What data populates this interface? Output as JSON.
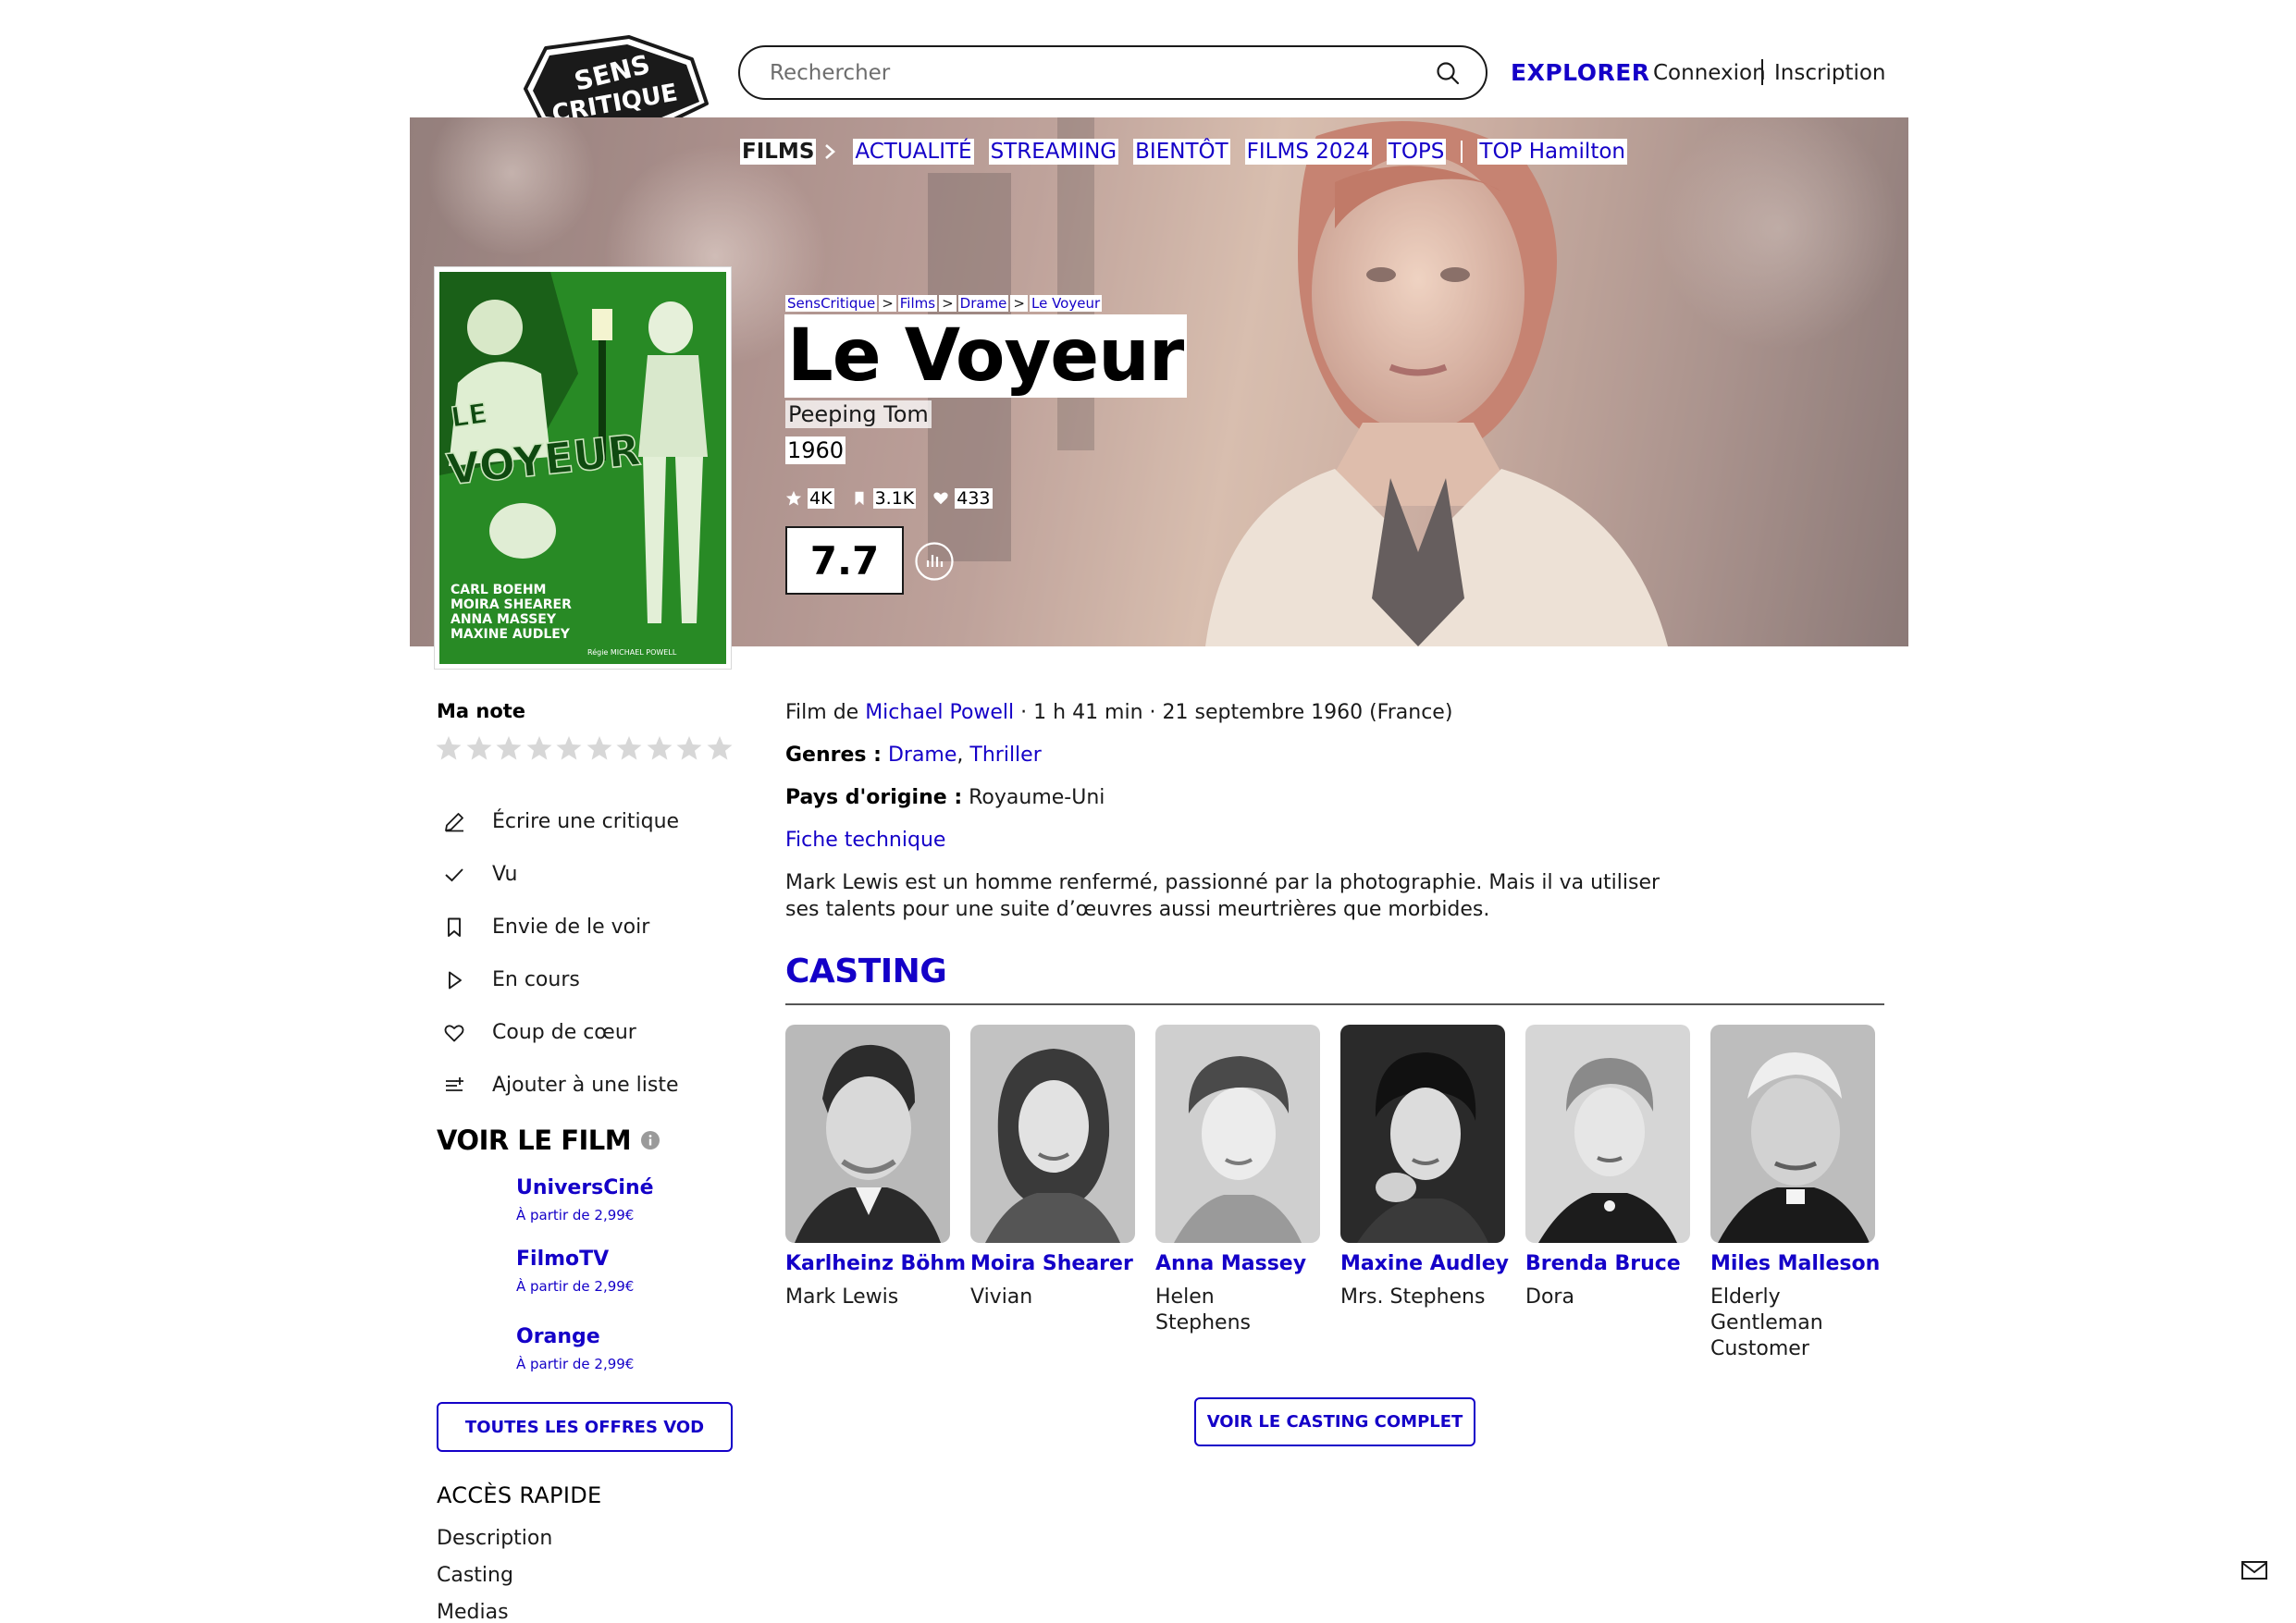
{
  "header": {
    "logo_line1": "SENS",
    "logo_line2": "CRITIQUE",
    "search_placeholder": "Rechercher",
    "explorer": "EXPLORER",
    "login": "Connexion",
    "signup": "Inscription"
  },
  "nav": {
    "items": [
      "FILMS",
      "ACTUALITÉ",
      "STREAMING",
      "BIENTÔT",
      "FILMS 2024",
      "TOPS",
      "TOP Hamilton"
    ]
  },
  "breadcrumb": [
    "SensCritique",
    "Films",
    "Drame",
    "Le Voyeur"
  ],
  "breadcrumb_sep": ">",
  "film": {
    "title": "Le Voyeur",
    "original_title": "Peeping Tom",
    "year": "1960",
    "stats": {
      "ratings": "4K",
      "wishlist": "3.1K",
      "favorites": "433"
    },
    "rating": "7.7",
    "poster": {
      "title_word1": "LE",
      "title_word2": "VOYEUR",
      "cast_lines": [
        "CARL BOEHM",
        "MOIRA SHEARER",
        "ANNA MASSEY",
        "MAXINE AUDLEY"
      ],
      "director_credit": "Régie MICHAEL POWELL"
    },
    "credits_prefix": "Film de",
    "director": "Michael Powell",
    "credits_suffix": "· 1 h 41 min · 21 septembre 1960 (France)",
    "genres_label": "Genres :",
    "genres": [
      "Drame",
      "Thriller"
    ],
    "genre_sep": ",",
    "country_label": "Pays d'origine :",
    "country": "Royaume-Uni",
    "tech_sheet": "Fiche technique",
    "synopsis": "Mark Lewis est un homme renfermé, passionné par la photographie. Mais il va utiliser ses talents pour une suite d’œuvres aussi meurtrières que morbides."
  },
  "sidebar": {
    "my_rating": "Ma note",
    "stars_count": 10,
    "actions": [
      {
        "icon": "pencil-icon",
        "label": "Écrire une critique"
      },
      {
        "icon": "check-icon",
        "label": "Vu"
      },
      {
        "icon": "bookmark-icon",
        "label": "Envie de le voir"
      },
      {
        "icon": "play-icon",
        "label": "En cours"
      },
      {
        "icon": "heart-icon",
        "label": "Coup de cœur"
      },
      {
        "icon": "list-add-icon",
        "label": "Ajouter à une liste"
      }
    ],
    "watch_title": "VOIR LE FILM",
    "vod": [
      {
        "name": "UniversCiné",
        "price": "À partir de 2,99€"
      },
      {
        "name": "FilmoTV",
        "price": "À partir de 2,99€"
      },
      {
        "name": "Orange",
        "price": "À partir de 2,99€"
      }
    ],
    "vod_all": "TOUTES LES OFFRES VOD",
    "quick_title": "ACCÈS RAPIDE",
    "quick_links": [
      "Description",
      "Casting",
      "Medias"
    ]
  },
  "casting": {
    "title": "CASTING",
    "members": [
      {
        "name": "Karlheinz Böhm",
        "role": "Mark Lewis"
      },
      {
        "name": "Moira Shearer",
        "role": "Vivian"
      },
      {
        "name": "Anna Massey",
        "role": "Helen Stephens"
      },
      {
        "name": "Maxine Audley",
        "role": "Mrs. Stephens"
      },
      {
        "name": "Brenda Bruce",
        "role": "Dora"
      },
      {
        "name": "Miles Malleson",
        "role": "Elderly Gentleman Customer"
      }
    ],
    "see_all": "VOIR LE CASTING COMPLET"
  },
  "colors": {
    "accent_blue": "#1400c8",
    "text": "#1a1a1a",
    "poster_green": "#2f9a2a"
  }
}
